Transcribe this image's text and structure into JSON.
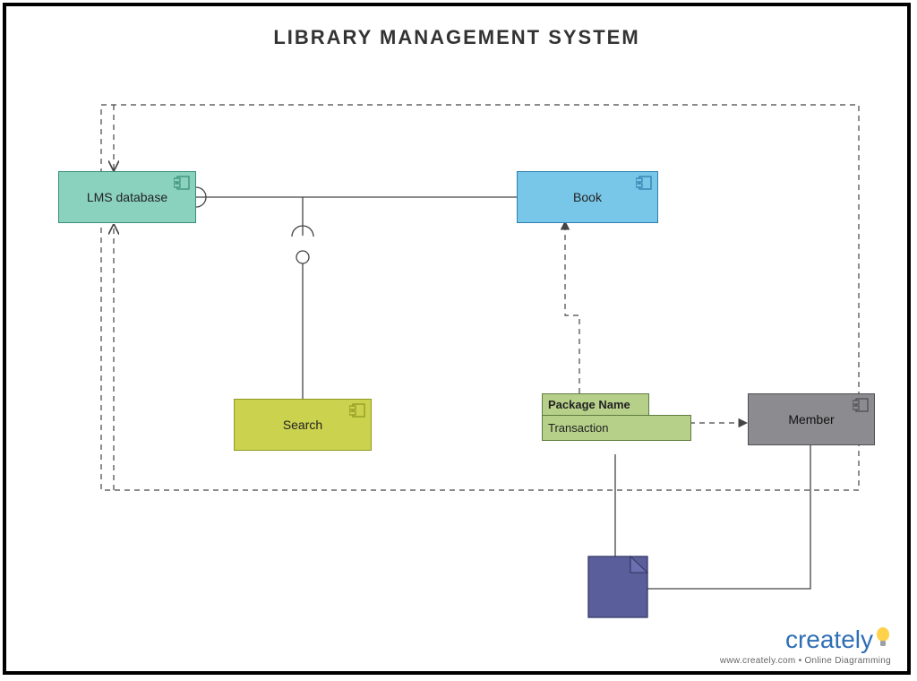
{
  "title": "LIBRARY MANAGEMENT SYSTEM",
  "nodes": {
    "lms": {
      "label": "LMS database"
    },
    "book": {
      "label": "Book"
    },
    "search": {
      "label": "Search"
    },
    "member": {
      "label": "Member"
    },
    "package": {
      "title": "Package Name",
      "body": "Transaction"
    }
  },
  "credit": {
    "brand": "creately",
    "tagline": "www.creately.com • Online Diagramming"
  },
  "colors": {
    "lms_fill": "#8AD2BE",
    "lms_stroke": "#3A8E78",
    "book_fill": "#79C7E8",
    "book_stroke": "#2E7FAE",
    "search_fill": "#CBD24E",
    "search_stroke": "#8F9A1F",
    "member_fill": "#8C8C90",
    "member_stroke": "#4F4F53",
    "package_fill": "#B6D08A",
    "package_stroke": "#5E7C3F",
    "note_fill": "#5A5E9A",
    "note_stroke": "#353866",
    "line": "#444"
  }
}
